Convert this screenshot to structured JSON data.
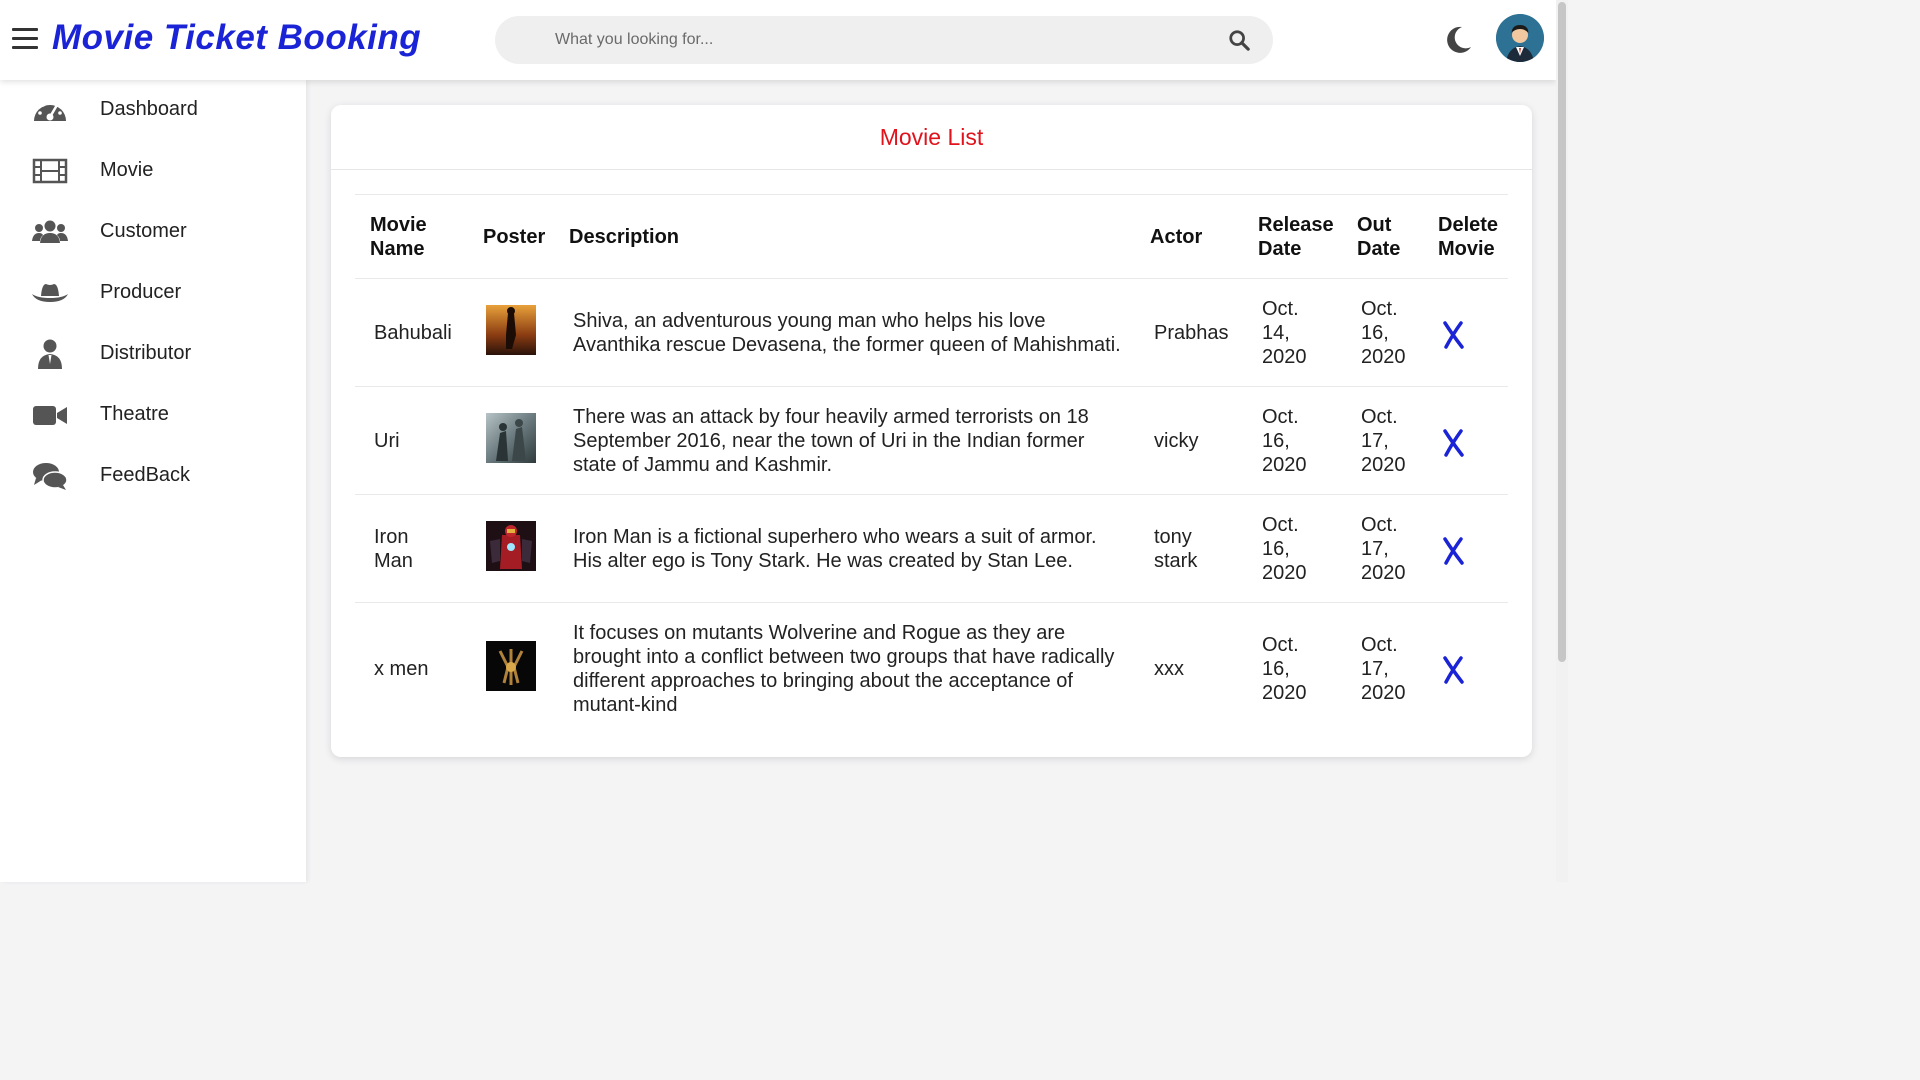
{
  "header": {
    "brand": "Movie Ticket Booking",
    "search_placeholder": "What you looking for...",
    "colors": {
      "brand": "#1a23d6"
    }
  },
  "sidebar": {
    "items": [
      {
        "label": "Dashboard",
        "icon": "dashboard-gauge-icon"
      },
      {
        "label": "Movie",
        "icon": "film-icon"
      },
      {
        "label": "Customer",
        "icon": "users-icon"
      },
      {
        "label": "Producer",
        "icon": "hat-icon"
      },
      {
        "label": "Distributor",
        "icon": "user-tie-icon"
      },
      {
        "label": "Theatre",
        "icon": "video-camera-icon"
      },
      {
        "label": "FeedBack",
        "icon": "comments-icon"
      }
    ]
  },
  "main": {
    "title": "Movie List",
    "title_color": "#e0121b",
    "columns": {
      "movie_name": "Movie Name",
      "poster": "Poster",
      "description": "Description",
      "actor": "Actor",
      "release_date": "Release Date",
      "out_date": "Out Date",
      "delete_movie": "Delete Movie"
    },
    "rows": [
      {
        "name": "Bahubali",
        "description": "Shiva, an adventurous young man who helps his love Avanthika rescue Devasena, the former queen of Mahishmati.",
        "actor": "Prabhas",
        "release_date": "Oct. 14, 2020",
        "out_date": "Oct. 16, 2020",
        "delete": "✗"
      },
      {
        "name": "Uri",
        "description": "There was an attack by four heavily armed terrorists on 18 September 2016, near the town of Uri in the Indian former state of Jammu and Kashmir.",
        "actor": "vicky",
        "release_date": "Oct. 16, 2020",
        "out_date": "Oct. 17, 2020",
        "delete": "✗"
      },
      {
        "name": "Iron Man",
        "description": "Iron Man is a fictional superhero who wears a suit of armor. His alter ego is Tony Stark. He was created by Stan Lee.",
        "actor": "tony stark",
        "release_date": "Oct. 16, 2020",
        "out_date": "Oct. 17, 2020",
        "delete": "✗"
      },
      {
        "name": "x men",
        "description": "It focuses on mutants Wolverine and Rogue as they are brought into a conflict between two groups that have radically different approaches to bringing about the acceptance of mutant-kind",
        "actor": "xxx",
        "release_date": "Oct. 16, 2020",
        "out_date": "Oct. 17, 2020",
        "delete": "✗"
      }
    ],
    "delete_color": "#1a23d6"
  }
}
